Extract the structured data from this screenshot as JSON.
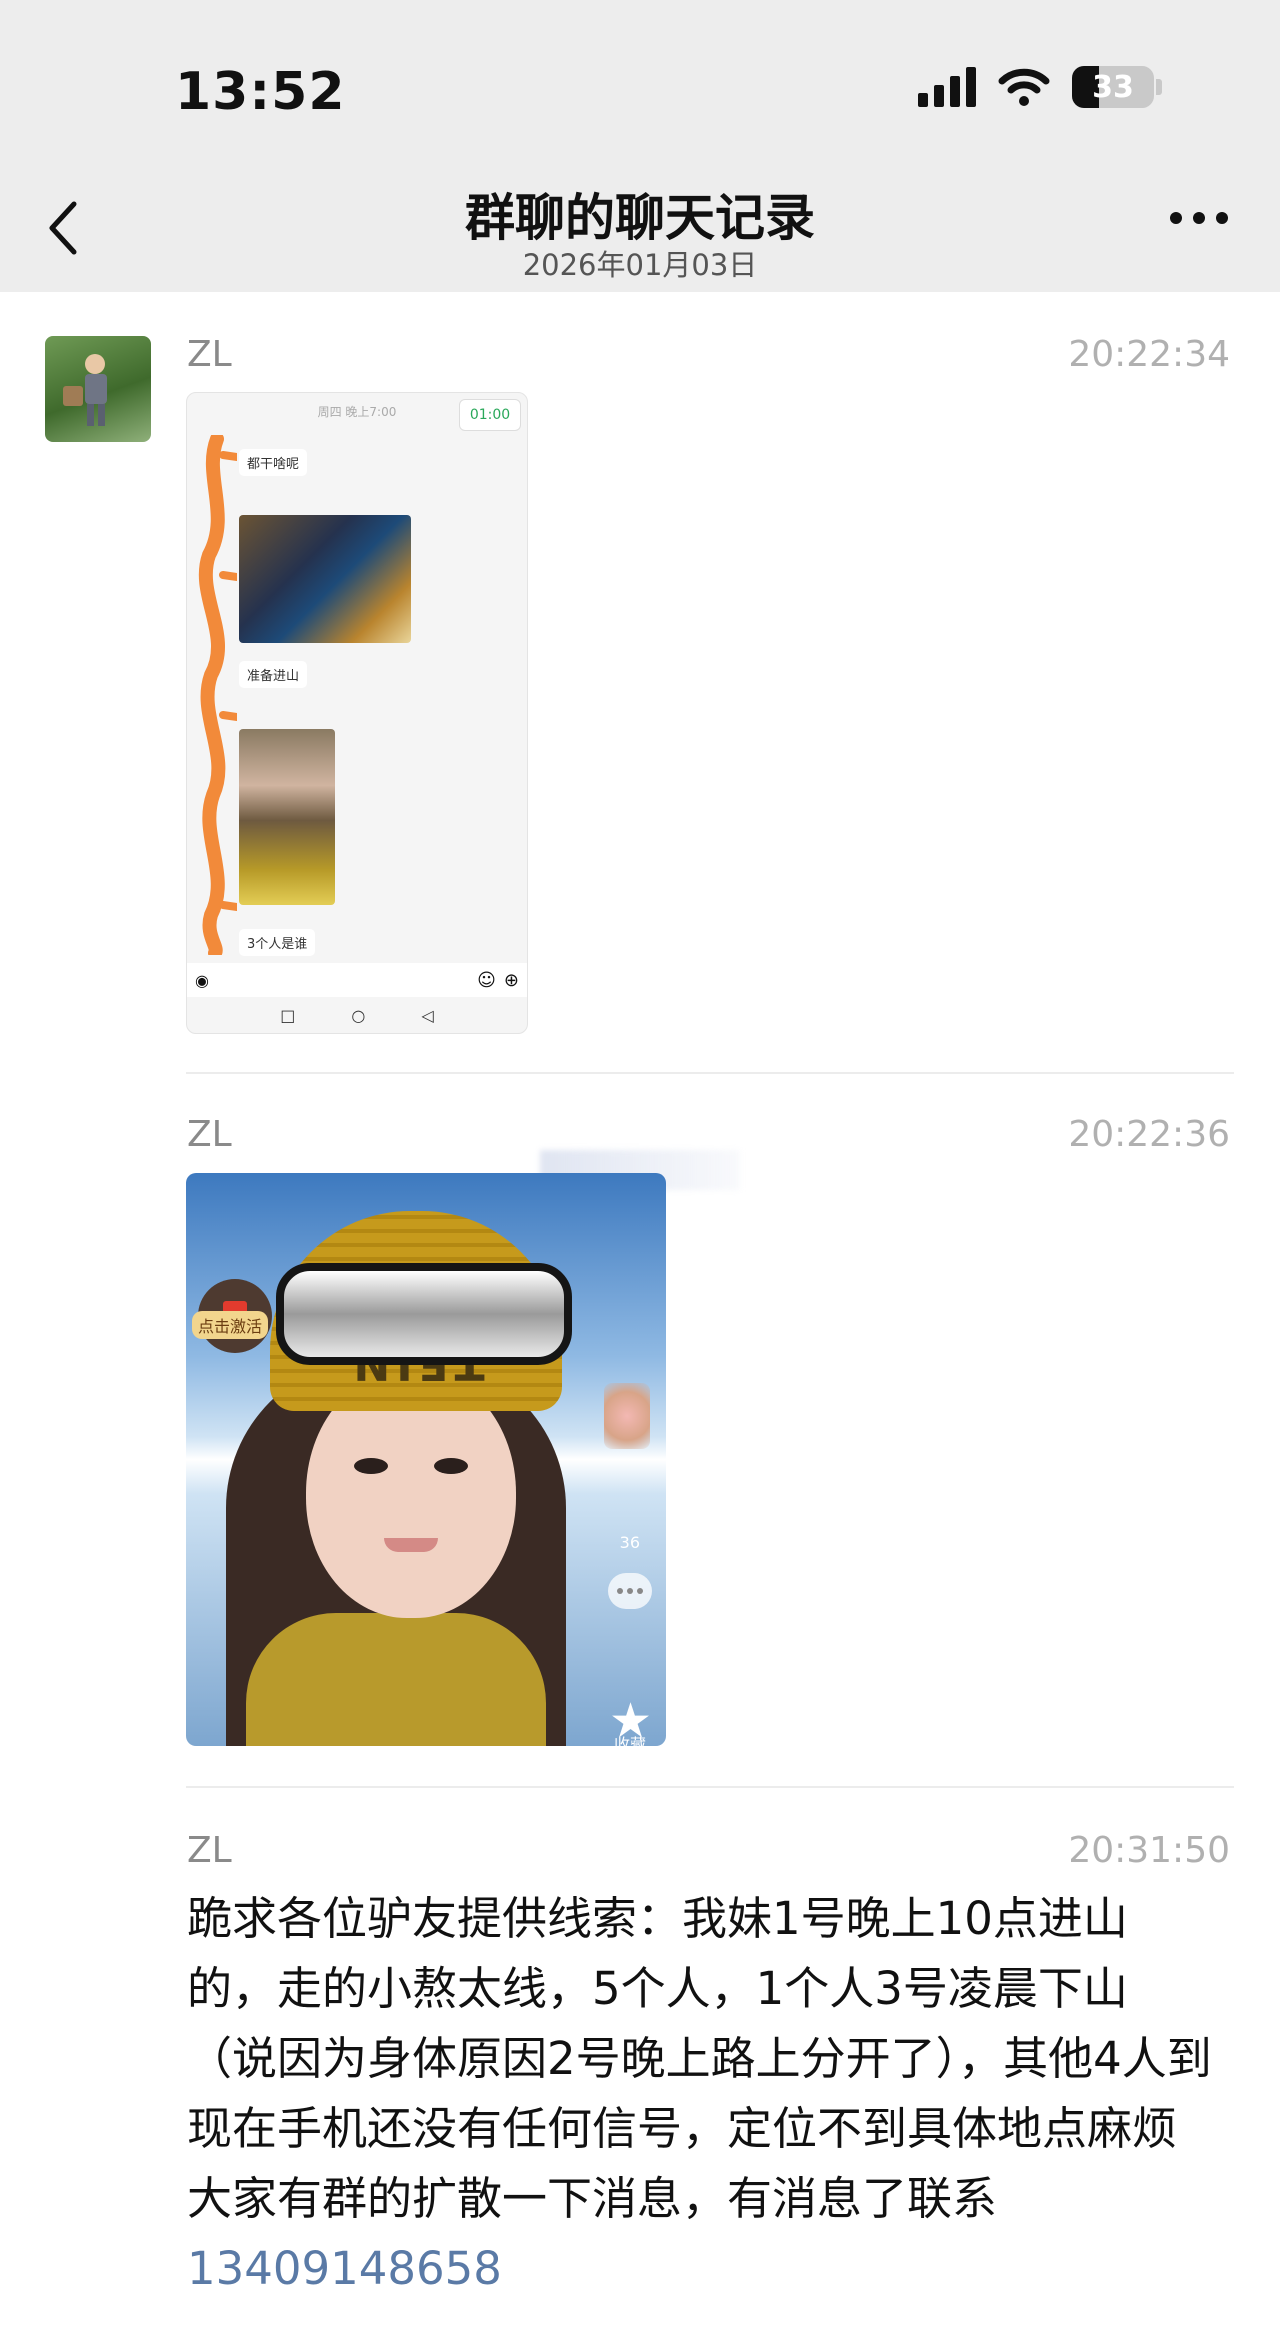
{
  "status_bar": {
    "time": "13:52",
    "battery": "33"
  },
  "header": {
    "title": "群聊的聊天记录",
    "date": "2026年01月03日"
  },
  "messages": [
    {
      "sender": "ZL",
      "time": "20:22:34",
      "type": "screenshot",
      "screenshot": {
        "top_label": "周四 晚上7:00",
        "timer": "01:00",
        "bubbles": [
          "都干啥呢",
          "准备进山",
          "3个人是谁"
        ]
      }
    },
    {
      "sender": "ZL",
      "time": "20:22:36",
      "type": "image",
      "image": {
        "beanie_text": "TEIN",
        "badge_label": "点击激活",
        "side_count": "36",
        "collect_label": "收藏"
      }
    },
    {
      "sender": "ZL",
      "time": "20:31:50",
      "type": "text",
      "text": "跪求各位驴友提供线索：我妹1号晚上10点进山的，走的小熬太线，5个人，1个人3号凌晨下山（说因为身体原因2号晚上路上分开了），其他4人到现在手机还没有任何信号，定位不到具体地点麻烦大家有群的扩散一下消息，有消息了联系",
      "phone": "13409148658"
    }
  ],
  "colors": {
    "header_bg": "#ededed",
    "link": "#5a7aa6",
    "meta_text": "#8a8a8a",
    "time_text": "#b0b0b0"
  },
  "icons": [
    "back-chevron-icon",
    "more-dots-icon",
    "signal-icon",
    "wifi-icon",
    "battery-icon"
  ]
}
